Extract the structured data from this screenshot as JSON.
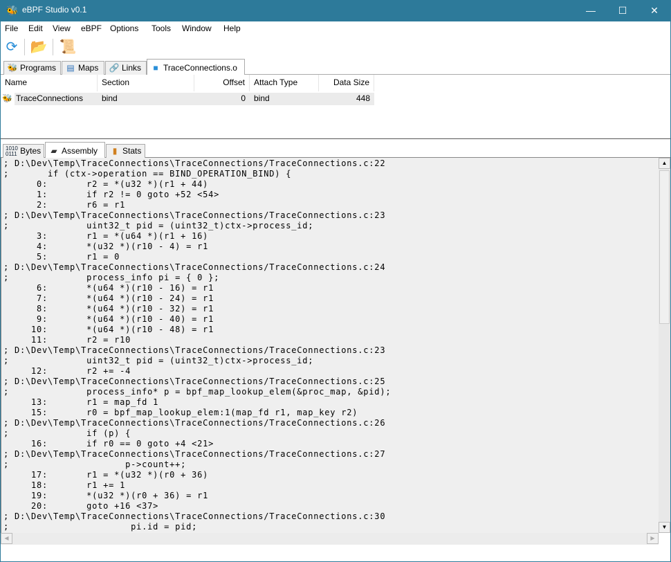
{
  "window": {
    "title": "eBPF Studio v0.1",
    "app_icon": "bee-icon",
    "minimize": "—",
    "maximize": "☐",
    "close": "✕"
  },
  "menu": [
    "File",
    "Edit",
    "View",
    "eBPF",
    "Options",
    "Tools",
    "Window",
    "Help"
  ],
  "toolbar": {
    "icons": [
      "refresh-icon",
      "open-folder-icon",
      "load-script-icon"
    ]
  },
  "tabs": [
    {
      "label": "Programs",
      "icon": "bee-icon"
    },
    {
      "label": "Maps",
      "icon": "database-icon"
    },
    {
      "label": "Links",
      "icon": "chain-link-icon"
    },
    {
      "label": "TraceConnections.o",
      "icon": "cube-icon",
      "active": true
    }
  ],
  "table": {
    "columns": [
      "Name",
      "Section",
      "Offset",
      "Attach Type",
      "Data Size"
    ],
    "rows": [
      {
        "name": "TraceConnections",
        "section": "bind",
        "offset": "0",
        "attach_type": "bind",
        "data_size": "448"
      }
    ]
  },
  "bottom_tabs": [
    {
      "label": "Bytes",
      "icon_text": "1010\n0111"
    },
    {
      "label": "Assembly",
      "icon": "chip-icon",
      "active": true
    },
    {
      "label": "Stats",
      "icon": "chart-icon"
    }
  ],
  "assembly": [
    "; D:\\Dev\\Temp\\TraceConnections\\TraceConnections/TraceConnections.c:22",
    ";       if (ctx->operation == BIND_OPERATION_BIND) {",
    "      0:       r2 = *(u32 *)(r1 + 44)",
    "      1:       if r2 != 0 goto +52 <54>",
    "      2:       r6 = r1",
    "; D:\\Dev\\Temp\\TraceConnections\\TraceConnections/TraceConnections.c:23",
    ";              uint32_t pid = (uint32_t)ctx->process_id;",
    "      3:       r1 = *(u64 *)(r1 + 16)",
    "      4:       *(u32 *)(r10 - 4) = r1",
    "      5:       r1 = 0",
    "; D:\\Dev\\Temp\\TraceConnections\\TraceConnections/TraceConnections.c:24",
    ";              process_info pi = { 0 };",
    "      6:       *(u64 *)(r10 - 16) = r1",
    "      7:       *(u64 *)(r10 - 24) = r1",
    "      8:       *(u64 *)(r10 - 32) = r1",
    "      9:       *(u64 *)(r10 - 40) = r1",
    "     10:       *(u64 *)(r10 - 48) = r1",
    "     11:       r2 = r10",
    "; D:\\Dev\\Temp\\TraceConnections\\TraceConnections/TraceConnections.c:23",
    ";              uint32_t pid = (uint32_t)ctx->process_id;",
    "     12:       r2 += -4",
    "; D:\\Dev\\Temp\\TraceConnections\\TraceConnections/TraceConnections.c:25",
    ";              process_info* p = bpf_map_lookup_elem(&proc_map, &pid);",
    "     13:       r1 = map_fd 1",
    "     15:       r0 = bpf_map_lookup_elem:1(map_fd r1, map_key r2)",
    "; D:\\Dev\\Temp\\TraceConnections\\TraceConnections/TraceConnections.c:26",
    ";              if (p) {",
    "     16:       if r0 == 0 goto +4 <21>",
    "; D:\\Dev\\Temp\\TraceConnections\\TraceConnections/TraceConnections.c:27",
    ";                     p->count++;",
    "     17:       r1 = *(u32 *)(r0 + 36)",
    "     18:       r1 += 1",
    "     19:       *(u32 *)(r0 + 36) = r1",
    "     20:       goto +16 <37>",
    "; D:\\Dev\\Temp\\TraceConnections\\TraceConnections/TraceConnections.c:30",
    ";                      pi.id = pid;"
  ]
}
